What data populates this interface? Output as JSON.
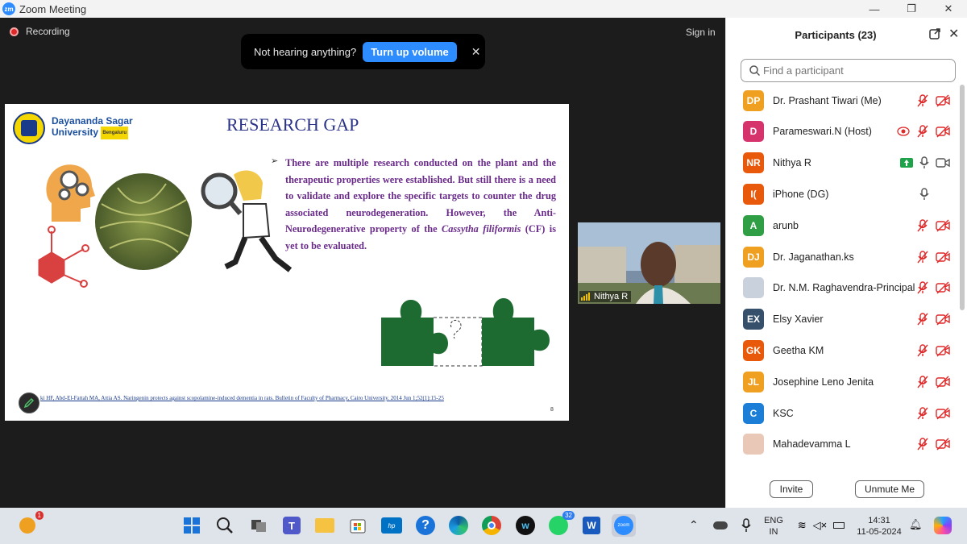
{
  "window": {
    "app_icon_text": "zm",
    "title": "Zoom Meeting",
    "minimize": "—",
    "restore": "❐",
    "close": "✕"
  },
  "meeting": {
    "recording_label": "Recording",
    "sign_in": "Sign in",
    "toast": {
      "message": "Not hearing anything?",
      "button": "Turn up volume",
      "close": "✕"
    }
  },
  "slide": {
    "logo_line1": "Dayananda Sagar",
    "logo_line2": "University",
    "logo_city": "Bengaluru",
    "title": "RESEARCH GAP",
    "bullet": "➢",
    "text_before": "There are multiple research conducted on the plant and the therapeutic properties were established. But still there is a need to validate and explore the specific targets to counter the drug associated neurodegeneration. However, the Anti-Neurodegenerative property of the ",
    "text_italic": "Cassytha filiformis",
    "text_after": " (CF) is yet to be evaluated.",
    "reference": "ki HF, Abd-El-Fattah MA, Attia AS. Naringenin protects against scopolamine-induced dementia in rats. Bulletin of Faculty of Pharmacy, Cairo University. 2014 Jun 1;52(1):15-25",
    "page_number": "8"
  },
  "video_tile": {
    "name": "Nithya R"
  },
  "participants": {
    "title": "Participants (23)",
    "search_placeholder": "Find a participant",
    "list": [
      {
        "initials": "DP",
        "name": "Dr. Prashant Tiwari (Me)",
        "color": "#f0a020",
        "rec": false,
        "share": false,
        "mic": "muted",
        "cam": "off"
      },
      {
        "initials": "D",
        "name": "Parameswari.N (Host)",
        "color": "#d6336c",
        "rec": true,
        "share": false,
        "mic": "muted",
        "cam": "off"
      },
      {
        "initials": "NR",
        "name": "Nithya R",
        "color": "#e8590c",
        "rec": false,
        "share": true,
        "mic": "on",
        "cam": "on"
      },
      {
        "initials": "I(",
        "name": "iPhone (DG)",
        "color": "#e8590c",
        "rec": false,
        "share": false,
        "mic": "on",
        "cam": "none"
      },
      {
        "initials": "A",
        "name": "arunb",
        "color": "#2f9e44",
        "rec": false,
        "share": false,
        "mic": "muted",
        "cam": "off"
      },
      {
        "initials": "DJ",
        "name": "Dr. Jaganathan.ks",
        "color": "#f0a020",
        "rec": false,
        "share": false,
        "mic": "muted",
        "cam": "off"
      },
      {
        "initials": "",
        "name": "Dr. N.M. Raghavendra-Principal",
        "color": "#c9d1dc",
        "rec": false,
        "share": false,
        "mic": "muted",
        "cam": "off"
      },
      {
        "initials": "EX",
        "name": "Elsy Xavier",
        "color": "#364f6b",
        "rec": false,
        "share": false,
        "mic": "muted",
        "cam": "off"
      },
      {
        "initials": "GK",
        "name": "Geetha KM",
        "color": "#e8590c",
        "rec": false,
        "share": false,
        "mic": "muted",
        "cam": "off"
      },
      {
        "initials": "JL",
        "name": "Josephine Leno Jenita",
        "color": "#f0a020",
        "rec": false,
        "share": false,
        "mic": "muted",
        "cam": "off"
      },
      {
        "initials": "C",
        "name": "KSC",
        "color": "#1c7ed6",
        "rec": false,
        "share": false,
        "mic": "muted",
        "cam": "off"
      },
      {
        "initials": "",
        "name": "Mahadevamma L",
        "color": "#e9c8b8",
        "rec": false,
        "share": false,
        "mic": "muted",
        "cam": "off"
      }
    ],
    "invite_button": "Invite",
    "unmute_button": "Unmute Me"
  },
  "taskbar": {
    "notif_badge": "1",
    "whatsapp_badge": "32",
    "lang_line1": "ENG",
    "lang_line2": "IN",
    "time": "14:31",
    "date": "11-05-2024",
    "hp_label": "hp",
    "word_label": "W",
    "zoom_label": "zoom"
  }
}
